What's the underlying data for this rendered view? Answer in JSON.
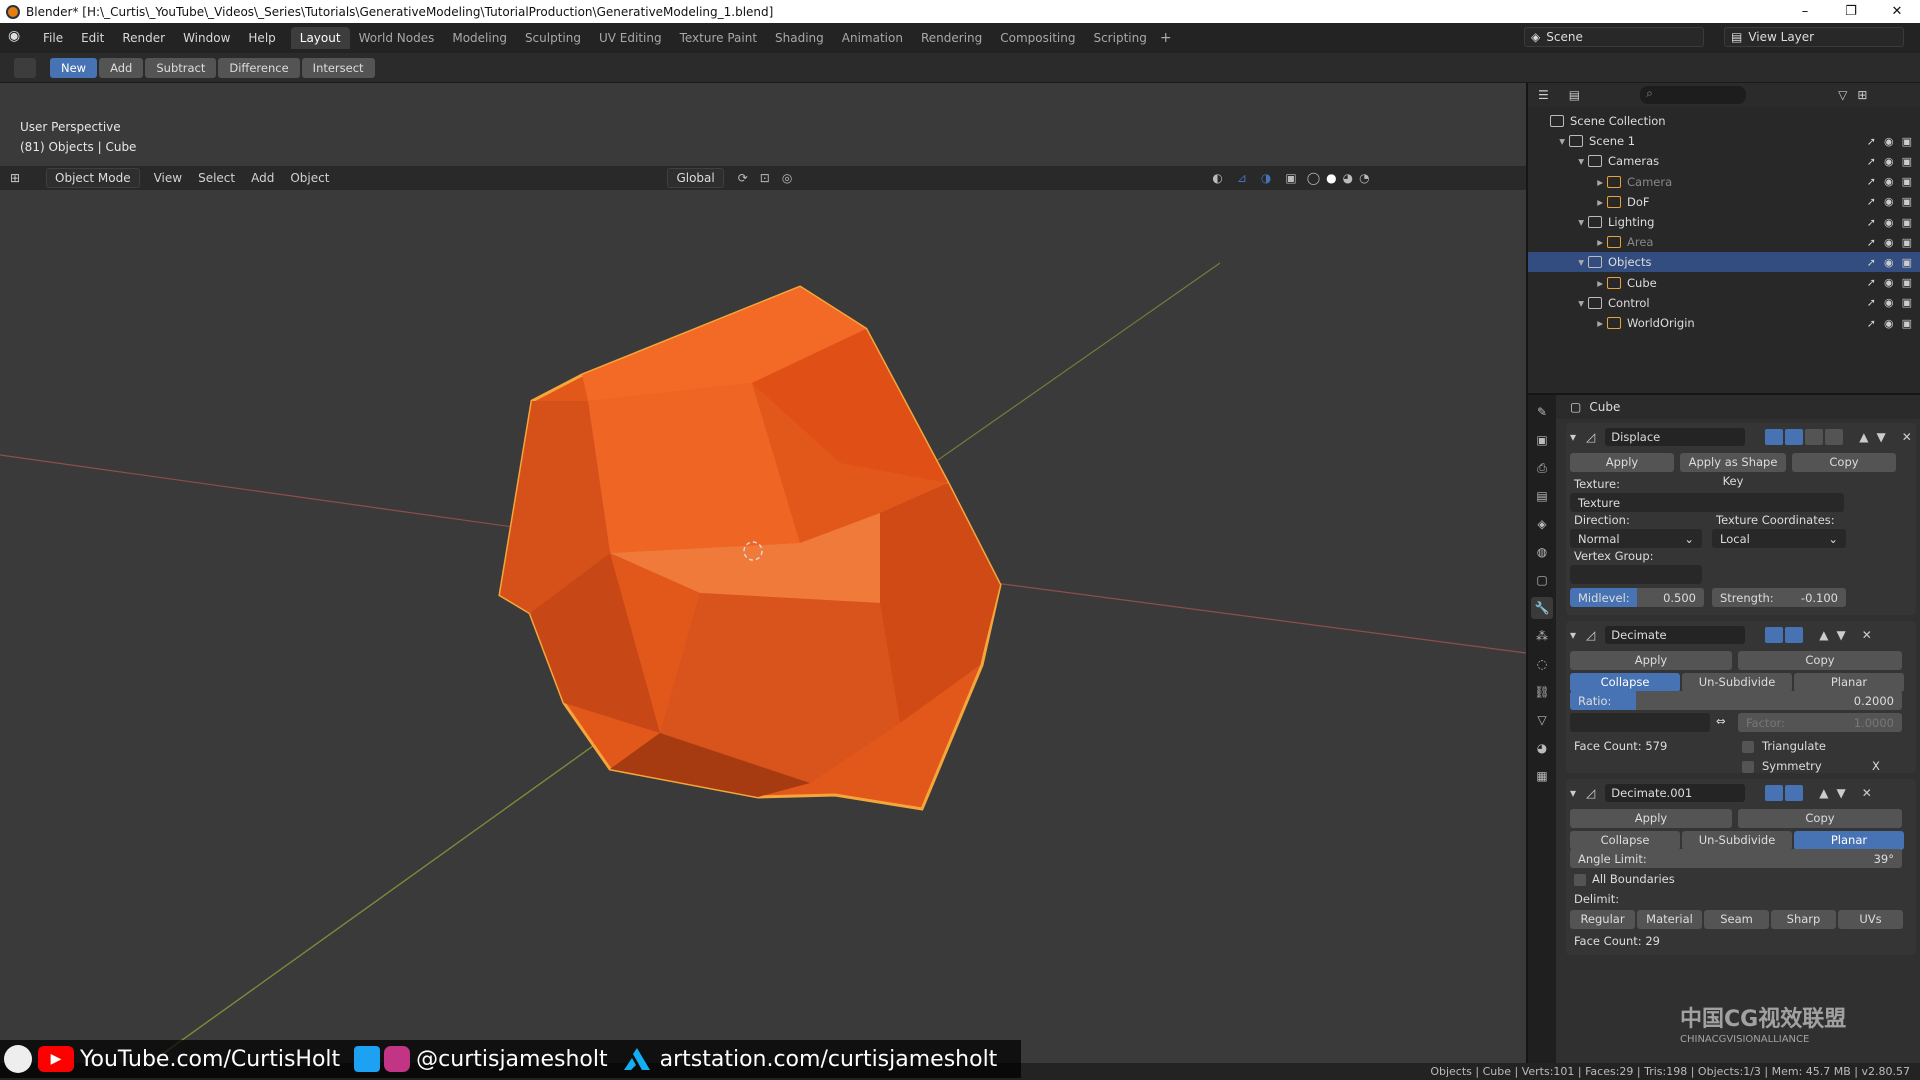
{
  "window": {
    "title": "Blender* [H:\\_Curtis\\_YouTube\\_Videos\\_Series\\Tutorials\\GenerativeModeling\\TutorialProduction\\GenerativeModeling_1.blend]",
    "min": "–",
    "max": "❐",
    "close": "✕"
  },
  "menu": [
    "File",
    "Edit",
    "Render",
    "Window",
    "Help"
  ],
  "workspaces": [
    "Layout",
    "World Nodes",
    "Modeling",
    "Sculpting",
    "UV Editing",
    "Texture Paint",
    "Shading",
    "Animation",
    "Rendering",
    "Compositing",
    "Scripting"
  ],
  "workspace_add": "+",
  "scene": "Scene",
  "view_layer": "View Layer",
  "bool_tools": [
    "New",
    "Add",
    "Subtract",
    "Difference",
    "Intersect"
  ],
  "viewport": {
    "mode": "Object Mode",
    "menus": [
      "View",
      "Select",
      "Add",
      "Object"
    ],
    "transform": "Global",
    "info_line1": "User Perspective",
    "info_line2": "(81) Objects | Cube"
  },
  "outliner": {
    "rows": [
      {
        "label": "Scene Collection",
        "depth": 0,
        "dim": false
      },
      {
        "label": "Scene 1",
        "depth": 1,
        "dim": false
      },
      {
        "label": "Cameras",
        "depth": 2,
        "dim": false
      },
      {
        "label": "Camera",
        "depth": 3,
        "dim": true
      },
      {
        "label": "DoF",
        "depth": 3,
        "dim": false
      },
      {
        "label": "Lighting",
        "depth": 2,
        "dim": false
      },
      {
        "label": "Area",
        "depth": 3,
        "dim": true
      },
      {
        "label": "Objects",
        "depth": 2,
        "dim": false,
        "selected": true
      },
      {
        "label": "Cube",
        "depth": 3,
        "dim": false
      },
      {
        "label": "Control",
        "depth": 2,
        "dim": false
      },
      {
        "label": "WorldOrigin",
        "depth": 3,
        "dim": false
      }
    ]
  },
  "properties": {
    "object": "Cube",
    "displace": {
      "name": "Displace",
      "apply": "Apply",
      "apply_shape": "Apply as Shape Key",
      "copy": "Copy",
      "texture_label": "Texture:",
      "texture": "Texture",
      "direction_label": "Direction:",
      "direction": "Normal",
      "coords_label": "Texture Coordinates:",
      "coords": "Local",
      "vgroup_label": "Vertex Group:",
      "midlevel_label": "Midlevel:",
      "midlevel": "0.500",
      "midlevel_fraction": 0.5,
      "strength_label": "Strength:",
      "strength": "-0.100"
    },
    "decimate": {
      "name": "Decimate",
      "apply": "Apply",
      "copy": "Copy",
      "modes": [
        "Collapse",
        "Un-Subdivide",
        "Planar"
      ],
      "active_mode": 0,
      "ratio_label": "Ratio:",
      "ratio": "0.2000",
      "ratio_fraction": 0.2,
      "factor_label": "Factor:",
      "factor": "1.0000",
      "face_count": "Face Count: 579",
      "triangulate": "Triangulate",
      "symmetry": "Symmetry",
      "axis": "X"
    },
    "decimate2": {
      "name": "Decimate.001",
      "apply": "Apply",
      "copy": "Copy",
      "modes": [
        "Collapse",
        "Un-Subdivide",
        "Planar"
      ],
      "active_mode": 2,
      "angle_label": "Angle Limit:",
      "angle": "39°",
      "all_boundaries": "All Boundaries",
      "delimit_label": "Delimit:",
      "delimit": [
        "Regular",
        "Material",
        "Seam",
        "Sharp",
        "UVs"
      ],
      "face_count": "Face Count: 29"
    }
  },
  "status": "Objects | Cube | Verts:101 | Faces:29 | Tris:198 | Objects:1/3 | Mem: 45.7 MB | v2.80.57",
  "social": {
    "youtube": "YouTube.com/CurtisHolt",
    "handle": "@curtisjameshol​t",
    "artstation": "artstation.com/curtisjameshol​t"
  },
  "watermark": {
    "line1": "中国CG视效联盟",
    "line2": "CHINACGVISIONALLIANCE"
  },
  "colors": {
    "accent": "#4772b3",
    "object": "#e2571a",
    "selection": "#f6a53a"
  }
}
